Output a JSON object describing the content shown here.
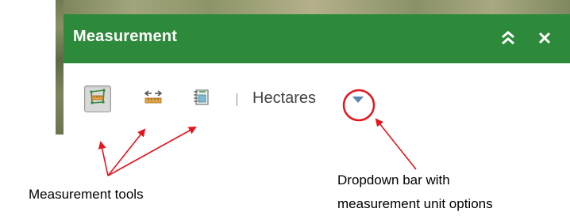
{
  "widget": {
    "title": "Measurement",
    "collapse_icon": "double-chevron-up-icon",
    "close_icon": "close-icon",
    "header_color": "#2e8a3b"
  },
  "toolbar": {
    "tools": [
      {
        "name": "area-measure-icon",
        "active": true
      },
      {
        "name": "distance-measure-icon",
        "active": false
      },
      {
        "name": "location-measure-icon",
        "active": false
      }
    ],
    "units_selected": "Hectares",
    "dropdown_icon": "caret-down-icon"
  },
  "annotations": {
    "tools_label": "Measurement tools",
    "dropdown_label_line1": "Dropdown bar with",
    "dropdown_label_line2": "measurement unit options",
    "arrow_color": "#e8141b"
  }
}
